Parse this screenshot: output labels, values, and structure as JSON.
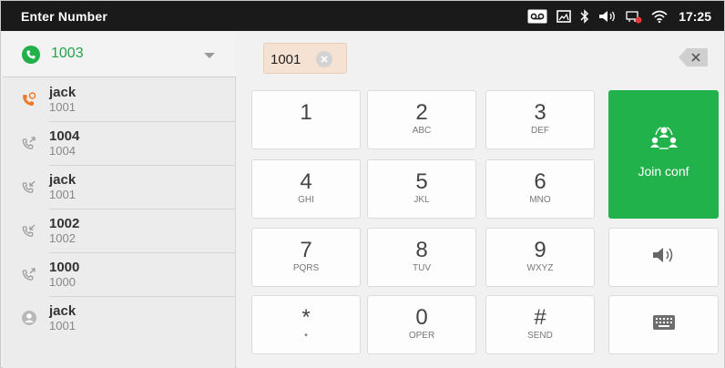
{
  "statusbar": {
    "title": "Enter Number",
    "time": "17:25",
    "icons": [
      "voicemail-icon",
      "screenshot-icon",
      "bluetooth-icon",
      "volume-icon",
      "network-icon",
      "wifi-icon"
    ]
  },
  "account": {
    "label": "1003",
    "icon": "phone-icon",
    "accent": "#22a24a"
  },
  "history": [
    {
      "name": "jack",
      "number": "1001",
      "icon": "missed-call-icon"
    },
    {
      "name": "1004",
      "number": "1004",
      "icon": "outgoing-call-icon"
    },
    {
      "name": "jack",
      "number": "1001",
      "icon": "incoming-call-icon"
    },
    {
      "name": "1002",
      "number": "1002",
      "icon": "incoming-call-icon"
    },
    {
      "name": "1000",
      "number": "1000",
      "icon": "outgoing-call-icon"
    },
    {
      "name": "jack",
      "number": "1001",
      "icon": "contact-icon"
    }
  ],
  "dial": {
    "chip": "1001",
    "keys": [
      {
        "digit": "1",
        "letters": ""
      },
      {
        "digit": "2",
        "letters": "ABC"
      },
      {
        "digit": "3",
        "letters": "DEF"
      },
      {
        "digit": "4",
        "letters": "GHI"
      },
      {
        "digit": "5",
        "letters": "JKL"
      },
      {
        "digit": "6",
        "letters": "MNO"
      },
      {
        "digit": "7",
        "letters": "PQRS"
      },
      {
        "digit": "8",
        "letters": "TUV"
      },
      {
        "digit": "9",
        "letters": "WXYZ"
      },
      {
        "digit": "*",
        "letters": "•"
      },
      {
        "digit": "0",
        "letters": "OPER"
      },
      {
        "digit": "#",
        "letters": "SEND"
      }
    ],
    "join_label": "Join conf",
    "join_color": "#21b24b"
  }
}
